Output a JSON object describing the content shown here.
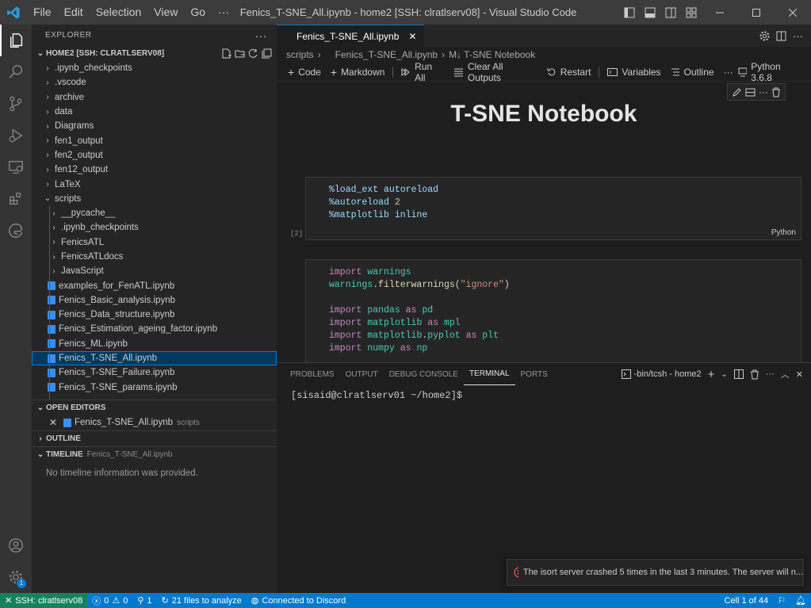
{
  "titlebar": {
    "menu": [
      "File",
      "Edit",
      "Selection",
      "View",
      "Go",
      "···"
    ],
    "title": "Fenics_T-SNE_All.ipynb - home2 [SSH: clratlserv08] - Visual Studio Code"
  },
  "explorer": {
    "header": "EXPLORER",
    "root": "HOME2 [SSH: CLRATLSERV08]",
    "items": [
      {
        "label": ".ipynb_checkpoints",
        "type": "folder"
      },
      {
        "label": ".vscode",
        "type": "folder"
      },
      {
        "label": "archive",
        "type": "folder"
      },
      {
        "label": "data",
        "type": "folder"
      },
      {
        "label": "Diagrams",
        "type": "folder"
      },
      {
        "label": "fen1_output",
        "type": "folder"
      },
      {
        "label": "fen2_output",
        "type": "folder"
      },
      {
        "label": "fen12_output",
        "type": "folder"
      },
      {
        "label": "LaTeX",
        "type": "folder"
      },
      {
        "label": "scripts",
        "type": "folder-open"
      },
      {
        "label": "__pycache__",
        "type": "folder",
        "depth": 1
      },
      {
        "label": ".ipynb_checkpoints",
        "type": "folder",
        "depth": 1
      },
      {
        "label": "FenicsATL",
        "type": "folder",
        "depth": 1
      },
      {
        "label": "FenicsATLdocs",
        "type": "folder",
        "depth": 1
      },
      {
        "label": "JavaScript",
        "type": "folder",
        "depth": 1
      },
      {
        "label": "examples_for_FenATL.ipynb",
        "type": "notebook",
        "depth": 1
      },
      {
        "label": "Fenics_Basic_analysis.ipynb",
        "type": "notebook",
        "depth": 1
      },
      {
        "label": "Fenics_Data_structure.ipynb",
        "type": "notebook",
        "depth": 1
      },
      {
        "label": "Fenics_Estimation_ageing_factor.ipynb",
        "type": "notebook",
        "depth": 1
      },
      {
        "label": "Fenics_ML.ipynb",
        "type": "notebook",
        "depth": 1
      },
      {
        "label": "Fenics_T-SNE_All.ipynb",
        "type": "notebook",
        "depth": 1,
        "selected": true
      },
      {
        "label": "Fenics_T-SNE_Failure.ipynb",
        "type": "notebook",
        "depth": 1
      },
      {
        "label": "Fenics_T-SNE_params.ipynb",
        "type": "notebook",
        "depth": 1
      }
    ],
    "open_editors": {
      "header": "OPEN EDITORS",
      "file": "Fenics_T-SNE_All.ipynb",
      "folder": "scripts"
    },
    "outline": {
      "header": "OUTLINE"
    },
    "timeline": {
      "header": "TIMELINE",
      "file": "Fenics_T-SNE_All.ipynb",
      "empty": "No timeline information was provided."
    }
  },
  "editor": {
    "tab": "Fenics_T-SNE_All.ipynb",
    "breadcrumb": [
      "scripts",
      "Fenics_T-SNE_All.ipynb",
      "M↓ T-SNE Notebook"
    ],
    "toolbar": {
      "code": "Code",
      "markdown": "Markdown",
      "run_all": "Run All",
      "clear": "Clear All Outputs",
      "restart": "Restart",
      "variables": "Variables",
      "outline": "Outline",
      "more": "···",
      "kernel": "Python 3.6.8"
    },
    "md_title": "T-SNE Notebook",
    "cell1": {
      "exec": "[2]",
      "lang": "Python"
    },
    "cell1_lines": [
      "%load_ext autoreload",
      "%autoreload 2",
      "%matplotlib inline"
    ],
    "cell2_lines": [
      "import warnings",
      "warnings.filterwarnings(\"ignore\")",
      "",
      "import pandas as pd",
      "import matplotlib as mpl",
      "import matplotlib.pyplot as plt",
      "import numpy as np"
    ]
  },
  "panel": {
    "tabs": [
      "PROBLEMS",
      "OUTPUT",
      "DEBUG CONSOLE",
      "TERMINAL",
      "PORTS"
    ],
    "active_tab": "TERMINAL",
    "shell": "-bin/tcsh - home2",
    "prompt": "[sisaid@clratlserv01 ~/home2]$"
  },
  "toast": {
    "message": "The isort server crashed 5 times in the last 3 minutes. The server will n..."
  },
  "statusbar": {
    "remote": "SSH: clratlserv08",
    "errors": "0",
    "warnings": "0",
    "ports": "1",
    "analyze": "21 files to analyze",
    "discord": "Connected to Discord",
    "cell": "Cell 1 of 44"
  },
  "colors": {
    "accent": "#007acc",
    "remote": "#16825d",
    "selection": "#04395e"
  }
}
